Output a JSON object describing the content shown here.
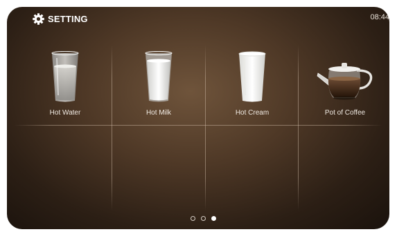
{
  "header": {
    "setting_label": "SETTING",
    "setting_icon": "gear-icon",
    "clock": "08:44"
  },
  "drinks": [
    {
      "label": "Hot Water",
      "icon": "glass-of-water-icon"
    },
    {
      "label": "Hot Milk",
      "icon": "glass-of-milk-icon"
    },
    {
      "label": "Hot Cream",
      "icon": "glass-of-cream-icon"
    },
    {
      "label": "Pot of Coffee",
      "icon": "coffee-pot-icon"
    }
  ],
  "pagination": {
    "pages": 3,
    "active_page": 3
  },
  "colors": {
    "background_center": "#6f543b",
    "background_edge": "#1a120c",
    "text": "#ffffff"
  }
}
